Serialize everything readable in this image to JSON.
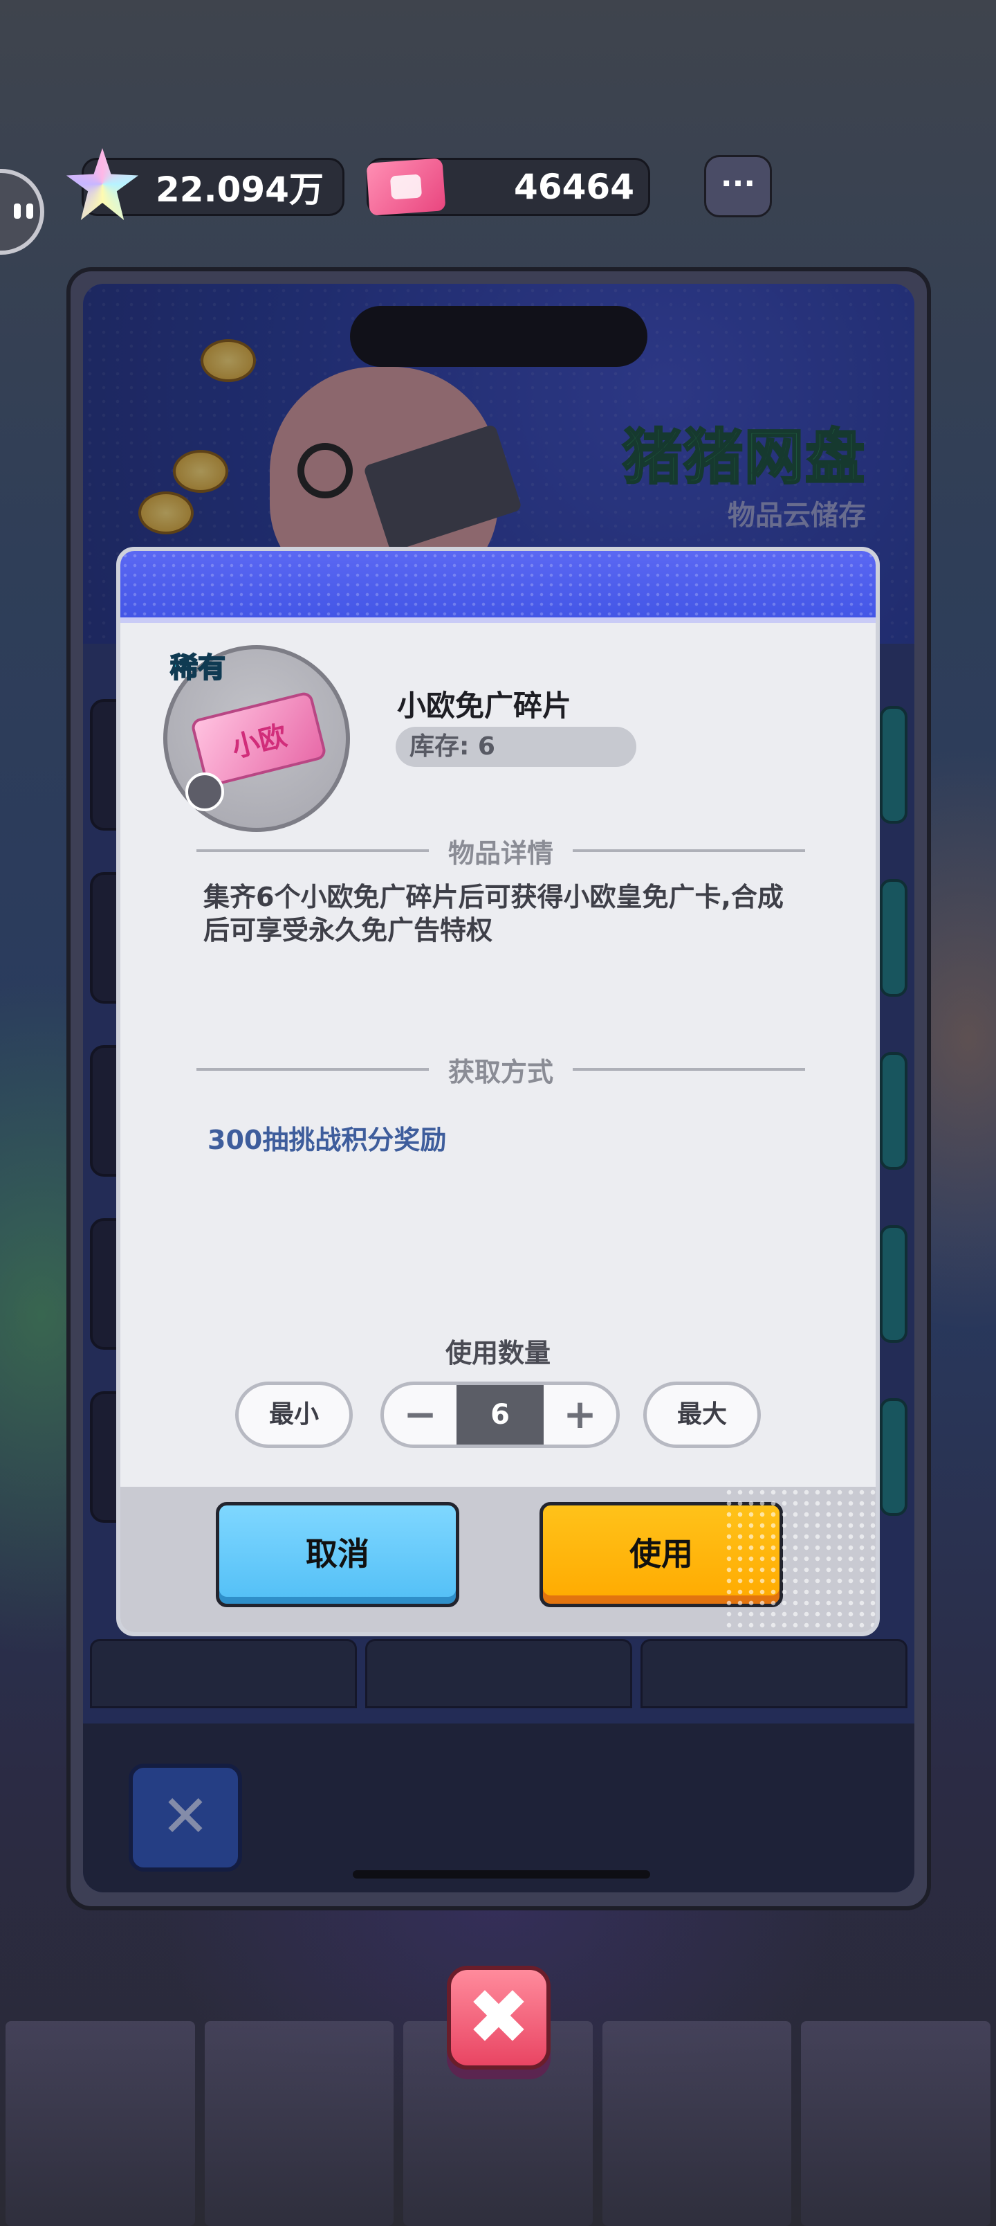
{
  "currency": {
    "stars": "22.094万",
    "tickets": "46464",
    "more_icon": "more-dots-icon"
  },
  "banner": {
    "title": "猪猪网盘",
    "subtitle": "物品云储存"
  },
  "item": {
    "rarity": "稀有",
    "card_text": "小欧",
    "name": "小欧免广碎片",
    "stock": "库存: 6",
    "detail_heading": "物品详情",
    "description": "集齐6个小欧免广碎片后可获得小欧皇免广卡,合成后可享受永久免广告特权",
    "source_heading": "获取方式",
    "source": "300抽挑战积分奖励"
  },
  "quantity": {
    "label": "使用数量",
    "min_label": "最小",
    "max_label": "最大",
    "minus": "−",
    "plus": "+",
    "value": "6"
  },
  "actions": {
    "cancel": "取消",
    "use": "使用"
  },
  "icons": {
    "close_square": "✕",
    "big_close": "✖"
  },
  "colors": {
    "modal_header": "#4356e6",
    "cancel_button": "#52bff6",
    "use_button": "#ffaa00",
    "close_button": "#e94563"
  }
}
